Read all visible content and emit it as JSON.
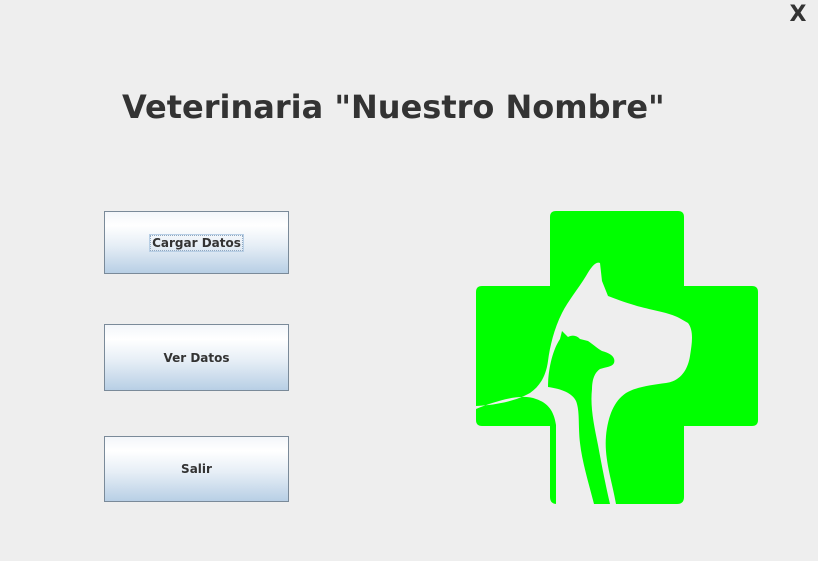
{
  "window": {
    "close_label": "X"
  },
  "header": {
    "title": "Veterinaria \"Nuestro Nombre\""
  },
  "menu": {
    "cargar_label": "Cargar Datos",
    "ver_label": "Ver Datos",
    "salir_label": "Salir"
  },
  "logo": {
    "icon": "veterinary-cross-pets-icon",
    "color": "#00ff00"
  }
}
